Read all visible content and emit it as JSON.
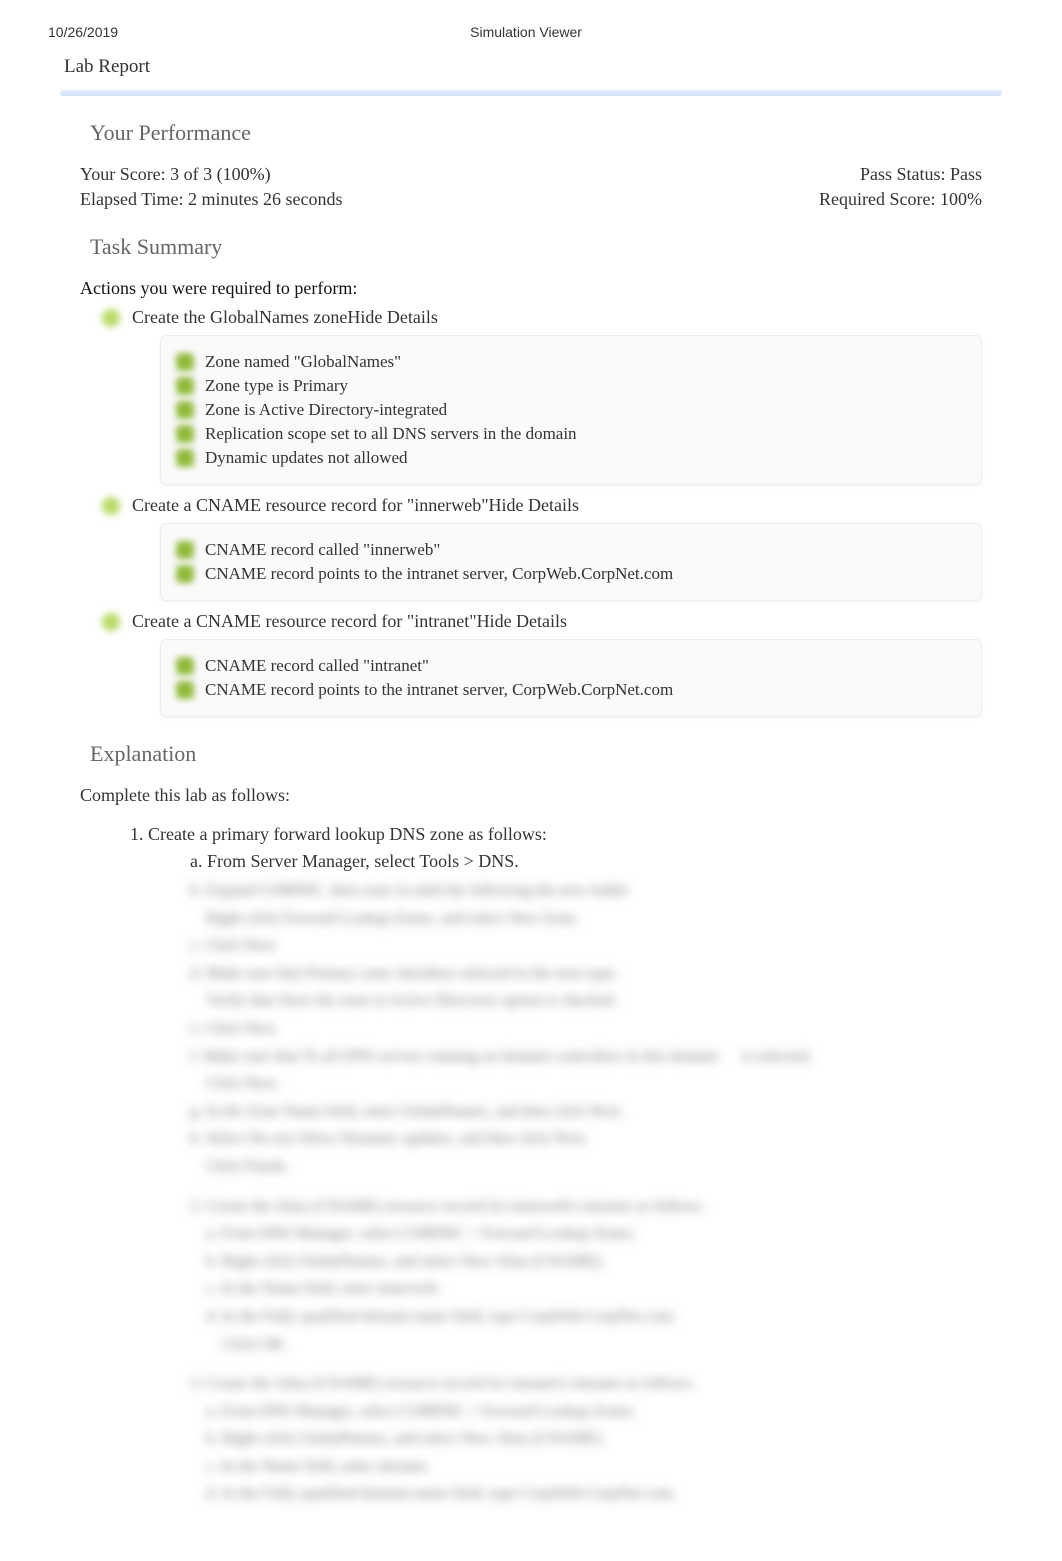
{
  "header": {
    "date": "10/26/2019",
    "title": "Simulation Viewer"
  },
  "lab_report_title": "Lab Report",
  "performance": {
    "heading": "Your Performance",
    "score_label": "Your Score: 3 of 3 (100%)",
    "pass_status": "Pass Status: Pass",
    "elapsed": "Elapsed Time: 2 minutes 26 seconds",
    "required": "Required Score: 100%"
  },
  "task_summary": {
    "heading": "Task Summary",
    "actions_label": "Actions you were required to perform:",
    "tasks": [
      {
        "title": "Create the GlobalNames zone",
        "toggle": "Hide Details",
        "details": [
          "Zone named \"GlobalNames\"",
          "Zone type is Primary",
          "Zone is Active Directory-integrated",
          "Replication scope set to all DNS servers in the domain",
          "Dynamic updates not allowed"
        ]
      },
      {
        "title": "Create a CNAME resource record for \"innerweb\"",
        "toggle": "Hide Details",
        "details": [
          "CNAME record called \"innerweb\"",
          "CNAME record points to the intranet server, CorpWeb.CorpNet.com"
        ]
      },
      {
        "title": "Create a CNAME resource record for \"intranet\"",
        "toggle": "Hide Details",
        "details": [
          "CNAME record called \"intranet\"",
          "CNAME record points to the intranet server, CorpWeb.CorpNet.com"
        ]
      }
    ]
  },
  "explanation": {
    "heading": "Explanation",
    "intro": "Complete this lab as follows:",
    "step1": "1. Create a primary forward lookup DNS zone as follows:",
    "step1a": "a. From Server Manager, select Tools > DNS."
  }
}
